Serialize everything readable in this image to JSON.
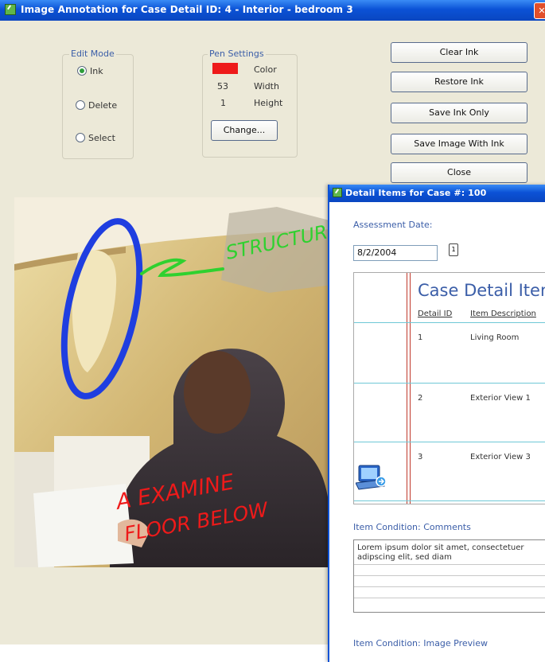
{
  "annotation_window": {
    "title": "Image Annotation for Case Detail ID: 4 - Interior - bedroom 3",
    "edit_mode": {
      "legend": "Edit Mode",
      "options": [
        {
          "label": "Ink",
          "selected": true
        },
        {
          "label": "Delete",
          "selected": false
        },
        {
          "label": "Select",
          "selected": false
        }
      ]
    },
    "pen_settings": {
      "legend": "Pen Settings",
      "color_label": "Color",
      "color_value": "#ee1a1a",
      "width_value": "53",
      "width_label": "Width",
      "height_value": "1",
      "height_label": "Height",
      "change_button": "Change..."
    },
    "buttons": {
      "clear_ink": "Clear Ink",
      "restore_ink": "Restore Ink",
      "save_ink_only": "Save Ink Only",
      "save_image_with_ink": "Save Image With Ink",
      "close": "Close"
    },
    "ink_annotations": {
      "structure": "STRUCTURE",
      "examine_line1": "A EXAMINE",
      "examine_line2": "FLOOR BELOW"
    },
    "colors": {
      "ink_blue": "#1f3ee0",
      "ink_green": "#2fd12f",
      "ink_red": "#ee1a1a"
    }
  },
  "detail_window": {
    "title": "Detail Items for Case #: 100",
    "assessment_label": "Assessment Date:",
    "assessment_date": "8/2/2004",
    "grid_title": "Case Detail Items",
    "columns": [
      "Detail ID",
      "Item Description"
    ],
    "rows": [
      {
        "id": "1",
        "description": "Living Room"
      },
      {
        "id": "2",
        "description": "Exterior View 1"
      },
      {
        "id": "3",
        "description": "Exterior View 3"
      }
    ],
    "comments_label": "Item Condition: Comments",
    "comments_text": "Lorem ipsum dolor sit amet, consectetuer adipscing elit, sed diam",
    "preview_label": "Item Condition: Image Preview"
  }
}
